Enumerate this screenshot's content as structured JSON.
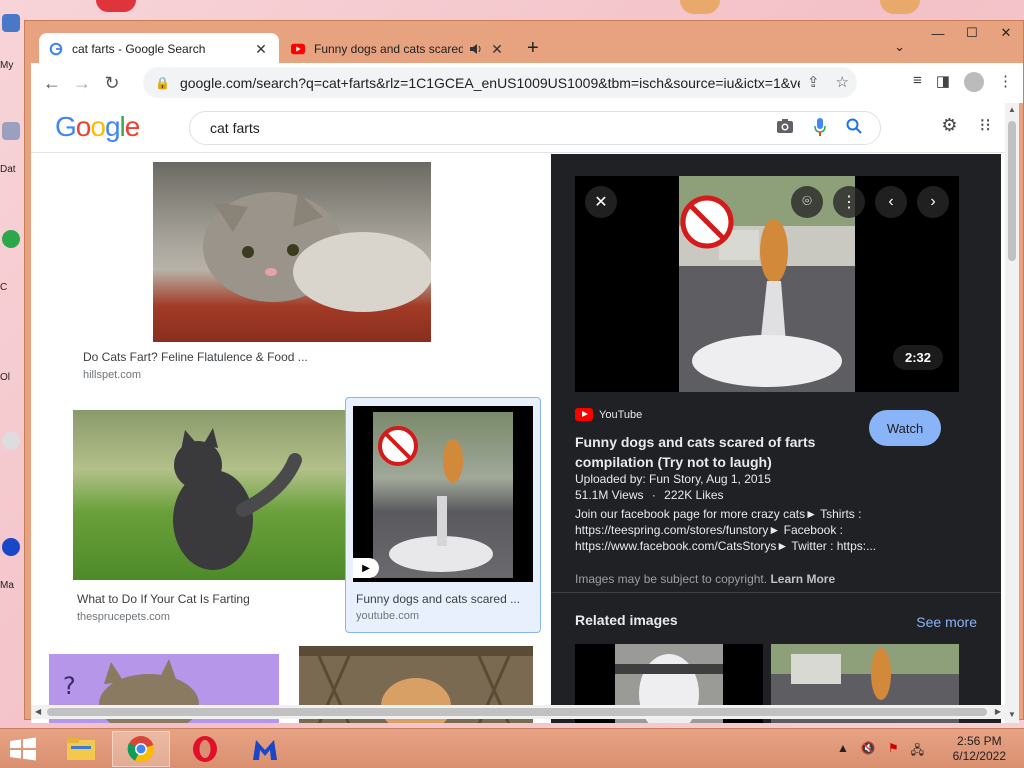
{
  "desktop": {
    "labels": [
      "My",
      "Dat",
      "C",
      "Ol",
      "Ma"
    ]
  },
  "window": {
    "minimize": "—",
    "maximize": "☐",
    "close": "✕"
  },
  "tabs": [
    {
      "title": "cat farts - Google Search",
      "close": "✕"
    },
    {
      "title": "Funny dogs and cats scared",
      "close": "✕"
    }
  ],
  "toolbar": {
    "url": "google.com/search?q=cat+farts&rlz=1C1GCEA_enUS1009US1009&tbm=isch&source=iu&ictx=1&ve..."
  },
  "google": {
    "logo": [
      "G",
      "o",
      "o",
      "g",
      "l",
      "e"
    ],
    "logo_colors": [
      "#4285f4",
      "#ea4335",
      "#fbbc05",
      "#4285f4",
      "#34a853",
      "#ea4335"
    ],
    "query": "cat farts"
  },
  "results": [
    {
      "title": "Do Cats Fart? Feline Flatulence & Food ...",
      "site": "hillspet.com"
    },
    {
      "title": "What to Do If Your Cat Is Farting",
      "site": "thesprucepets.com"
    },
    {
      "title": "Funny dogs and cats scared ...",
      "site": "youtube.com"
    }
  ],
  "panel": {
    "duration": "2:32",
    "source": "YouTube",
    "watch": "Watch",
    "title": "Funny dogs and cats scared of farts compilation (Try not to laugh)",
    "uploaded": "Uploaded by: Fun Story, Aug 1, 2015",
    "views": "51.1M Views",
    "dot": "·",
    "likes": "222K Likes",
    "description": "Join our facebook page for more crazy cats► Tshirts : https://teespring.com/stores/funstory► Facebook : https://www.facebook.com/CatsStorys► Twitter : https:...",
    "copyright": "Images may be subject to copyright.",
    "learn_more": "Learn More",
    "related": "Related images",
    "see_more": "See more"
  },
  "taskbar": {
    "time": "2:56 PM",
    "date": "6/12/2022"
  },
  "colors": {
    "accent": "#8ab4f8",
    "panel_bg": "#202124",
    "window_frame": "#e7a37f"
  }
}
